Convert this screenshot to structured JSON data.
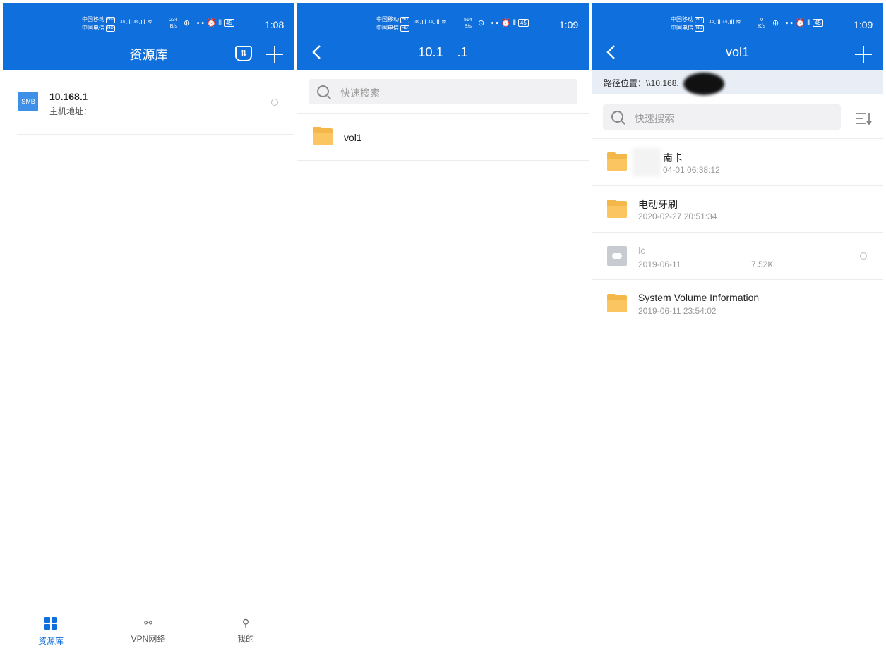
{
  "screen1": {
    "status": {
      "carrier1": "中国移动",
      "carrier2": "中国电信",
      "speed_value": "234",
      "speed_unit": "B/s",
      "battery": "45",
      "time": "1:08"
    },
    "header": {
      "title": "资源库"
    },
    "servers": [
      {
        "type": "SMB",
        "name": "10.168.1",
        "address_label": "主机地址："
      }
    ],
    "nav": [
      {
        "label": "资源库"
      },
      {
        "label": "VPN网络"
      },
      {
        "label": "我的"
      }
    ]
  },
  "screen2": {
    "status": {
      "carrier1": "中国移动",
      "carrier2": "中国电信",
      "speed_value": "514",
      "speed_unit": "B/s",
      "battery": "45",
      "time": "1:09"
    },
    "header": {
      "title": "10.1    .1"
    },
    "search": {
      "placeholder": "快速搜索"
    },
    "items": [
      {
        "name": "vol1"
      }
    ]
  },
  "screen3": {
    "status": {
      "carrier1": "中国移动",
      "carrier2": "中国电信",
      "speed_value": "0",
      "speed_unit": "K/s",
      "battery": "45",
      "time": "1:09"
    },
    "header": {
      "title": "vol1"
    },
    "path": {
      "label": "路径位置：\\\\10.168.    .1"
    },
    "search": {
      "placeholder": "快速搜索"
    },
    "items": [
      {
        "name": "南卡",
        "date": "04-01 06:38:12",
        "icon": "folder-icon"
      },
      {
        "name": "电动牙刷",
        "date": "2020-02-27 20:51:34",
        "icon": "folder-icon"
      },
      {
        "name": "lc",
        "date": "2019-06-11",
        "size": "7.52K",
        "icon": "cloud-file-icon"
      },
      {
        "name": "System Volume Information",
        "date": "2019-06-11 23:54:02",
        "icon": "folder-icon"
      }
    ]
  },
  "colors": {
    "accent": "#0f6fdc",
    "folder": "#fbc661",
    "path_bg": "#e9edf5"
  }
}
